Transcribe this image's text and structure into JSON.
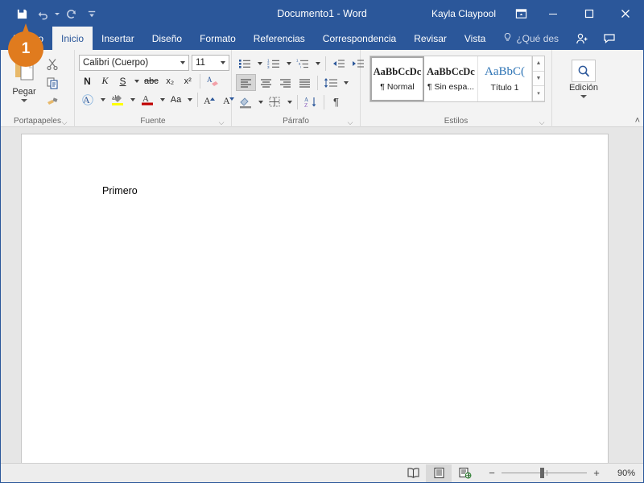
{
  "titlebar": {
    "quick_access": [
      {
        "name": "save",
        "icon": "save-icon"
      },
      {
        "name": "undo",
        "icon": "undo-icon"
      },
      {
        "name": "redo",
        "icon": "redo-icon"
      },
      {
        "name": "customize-qat",
        "icon": "chevron-down-icon"
      }
    ],
    "document_title": "Documento1  -  Word",
    "user_name": "Kayla Claypool",
    "ribbon_display_icon": "ribbon-display-options-icon",
    "minimize_label": "—",
    "maximize_label": "☐",
    "close_label": "✕"
  },
  "tabs": [
    {
      "label": "Archivo",
      "active": false
    },
    {
      "label": "Inicio",
      "active": true
    },
    {
      "label": "Insertar",
      "active": false
    },
    {
      "label": "Diseño",
      "active": false
    },
    {
      "label": "Formato",
      "active": false
    },
    {
      "label": "Referencias",
      "active": false
    },
    {
      "label": "Correspondencia",
      "active": false
    },
    {
      "label": "Revisar",
      "active": false
    },
    {
      "label": "Vista",
      "active": false
    }
  ],
  "tell_me": {
    "label": "¿Qué des",
    "icon": "lightbulb-icon"
  },
  "tab_icons": [
    {
      "name": "share-person-icon"
    },
    {
      "name": "comments-icon"
    }
  ],
  "ribbon": {
    "clipboard": {
      "label": "Portapapeles",
      "paste_label": "Pegar",
      "cut_name": "cut-icon",
      "copy_name": "copy-icon",
      "format_painter_name": "format-painter-icon"
    },
    "font": {
      "label": "Fuente",
      "font_family": "Calibri (Cuerpo)",
      "font_size": "11",
      "bold": "N",
      "italic": "K",
      "underline": "S",
      "strikethrough": "abc",
      "subscript": "x₂",
      "superscript": "x²",
      "clear_format": "clear-formatting-icon",
      "text_effects": "A",
      "highlight": "ab",
      "font_color": "A",
      "change_case": "Aa",
      "grow_font": "A",
      "shrink_font": "A"
    },
    "paragraph": {
      "label": "Párrafo",
      "bullets": "bullet-list-icon",
      "numbering": "numbered-list-icon",
      "multilevel": "multilevel-list-icon",
      "decrease_indent": "decrease-indent-icon",
      "increase_indent": "increase-indent-icon",
      "align_left": "align-left-icon",
      "align_center": "align-center-icon",
      "align_right": "align-right-icon",
      "justify": "justify-icon",
      "line_spacing": "line-spacing-icon",
      "shading": "shading-icon",
      "borders": "borders-icon",
      "sort": "sort-az-icon",
      "show_marks": "¶"
    },
    "styles": {
      "label": "Estilos",
      "items": [
        {
          "sample": "AaBbCcDc",
          "name": "¶ Normal",
          "selected": true
        },
        {
          "sample": "AaBbCcDc",
          "name": "¶ Sin espa...",
          "selected": false
        },
        {
          "sample": "AaBbC(",
          "name": "Título 1",
          "selected": false
        }
      ]
    },
    "editing": {
      "label": "Edición",
      "icon": "search-icon"
    },
    "collapse_label": "˄"
  },
  "document": {
    "body_text": "Primero"
  },
  "statusbar": {
    "left_text": "",
    "views": [
      {
        "name": "read-mode",
        "icon": "read-mode-icon",
        "selected": false
      },
      {
        "name": "print-layout",
        "icon": "print-layout-icon",
        "selected": true
      },
      {
        "name": "web-layout",
        "icon": "web-layout-icon",
        "selected": false
      }
    ],
    "zoom_out": "−",
    "zoom_in": "+",
    "zoom_level": "90%"
  },
  "marker": {
    "number": "1",
    "color": "#e07b1e"
  },
  "colors": {
    "word_blue": "#2b579a",
    "ribbon_bg": "#f3f3f3",
    "canvas_bg": "#e6e6e6",
    "accent_orange": "#e07b1e"
  }
}
